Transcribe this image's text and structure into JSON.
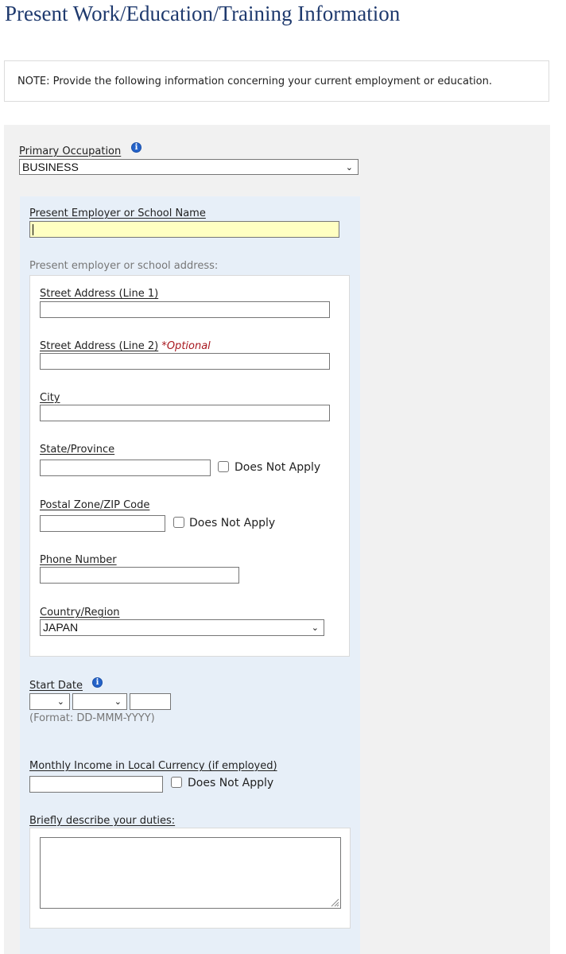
{
  "page": {
    "title": "Present Work/Education/Training Information"
  },
  "note": {
    "text": "NOTE: Provide the following information concerning your current employment or education."
  },
  "occupation": {
    "label": "Primary Occupation",
    "value": "BUSINESS"
  },
  "employer": {
    "label": "Present Employer or School Name",
    "value": ""
  },
  "address": {
    "section_label": "Present employer or school address:",
    "street1_label": "Street Address (Line 1)",
    "street2_label": "Street Address (Line 2)",
    "optional_text": "*Optional",
    "city_label": "City",
    "state_label": "State/Province",
    "postal_label": "Postal Zone/ZIP Code",
    "phone_label": "Phone Number",
    "country_label": "Country/Region",
    "country_value": "JAPAN",
    "does_not_apply": "Does Not Apply"
  },
  "start_date": {
    "label": "Start Date",
    "day": "",
    "month": "",
    "year": "",
    "format_hint": "(Format: DD-MMM-YYYY)"
  },
  "income": {
    "label": "Monthly Income in Local Currency (if employed)",
    "does_not_apply": "Does Not Apply"
  },
  "duties": {
    "label": "Briefly describe your duties:",
    "value": ""
  },
  "colors": {
    "title": "#1f3a6e",
    "panel_gray": "#f1f1f1",
    "panel_blue": "#e7eff8",
    "focused_input": "#ffffc2",
    "optional_red": "#a8181f",
    "info_icon": "#2563c9"
  },
  "icons": {
    "info": "info-icon",
    "dropdown": "chevron-down-icon",
    "resize": "resize-grip-icon"
  }
}
